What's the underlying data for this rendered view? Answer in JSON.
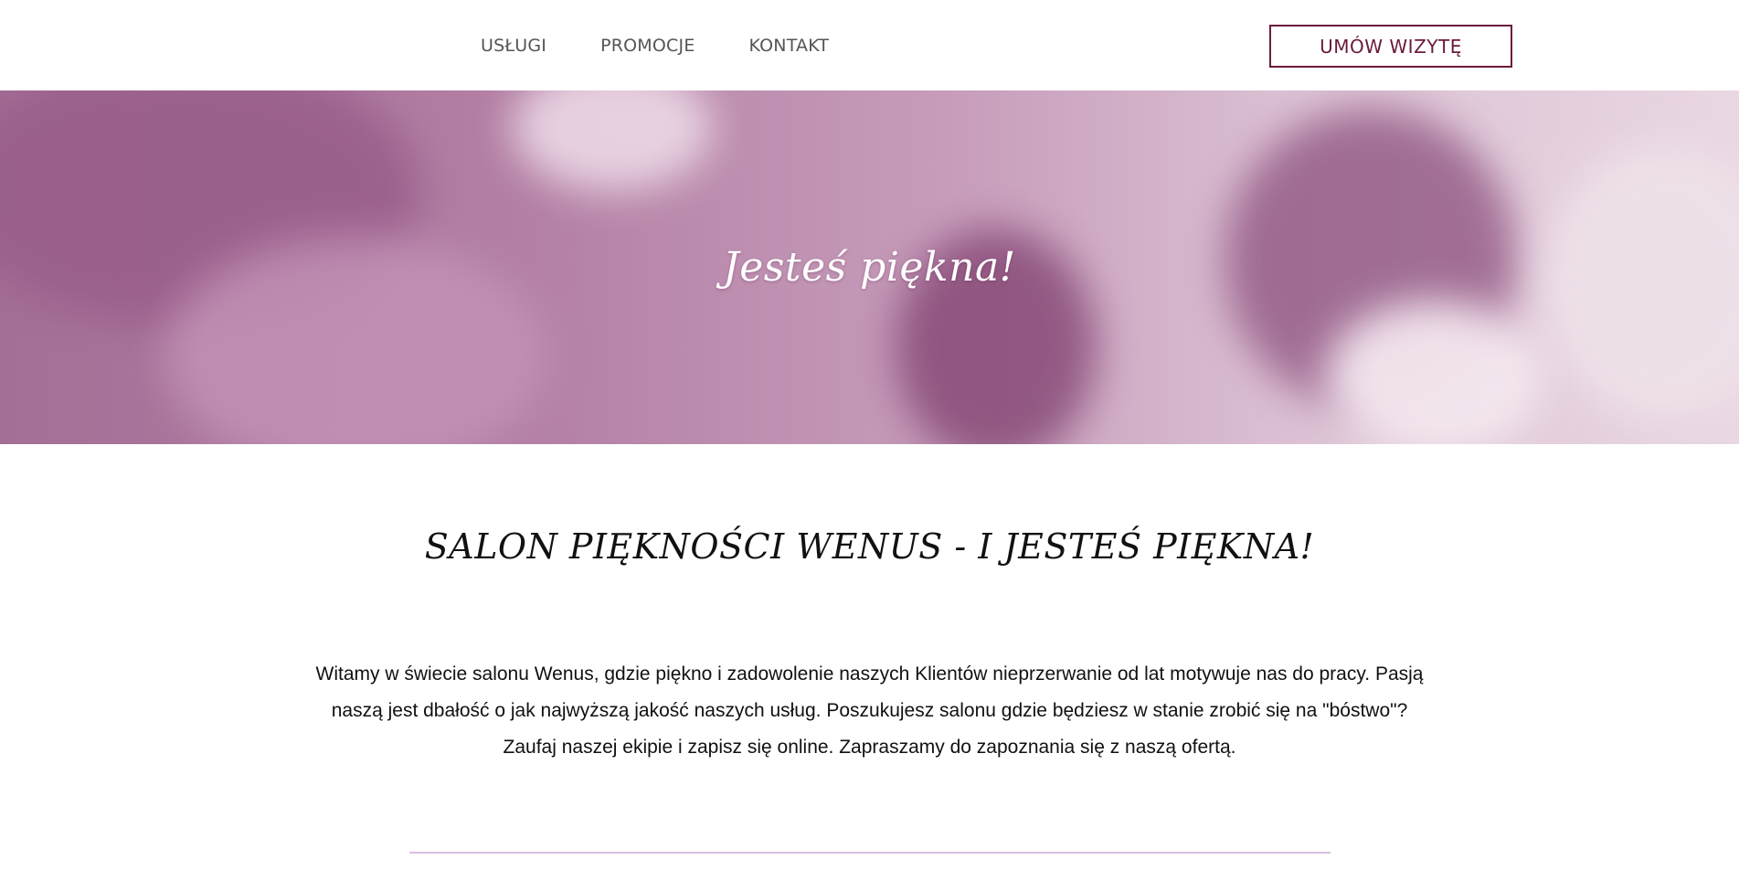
{
  "nav": {
    "items": [
      {
        "label": "USŁUGI"
      },
      {
        "label": "PROMOCJE"
      },
      {
        "label": "KONTAKT"
      }
    ],
    "cta_label": "UMÓW WIZYTĘ"
  },
  "hero": {
    "title": "Jesteś piękna!"
  },
  "main": {
    "section_title": "SALON PIĘKNOŚCI WENUS - I JESTEŚ PIĘKNA!",
    "intro_line_1": "Witamy w świecie salonu Wenus, gdzie piękno i zadowolenie naszych Klientów nieprzerwanie od lat motywuje nas do pracy. Pasją",
    "intro_line_2": "naszą jest dbałość o jak najwyższą jakość naszych usług. Poszukujesz salonu gdzie będziesz w stanie zrobić się na \"bóstwo\"?",
    "intro_line_3": "Zaufaj naszej ekipie i zapisz się online. Zapraszamy do zapoznania się z naszą ofertą."
  },
  "colors": {
    "accent": "#6b1a3e",
    "hero_tint": "#a46f96",
    "divider": "#d8bfe0"
  }
}
